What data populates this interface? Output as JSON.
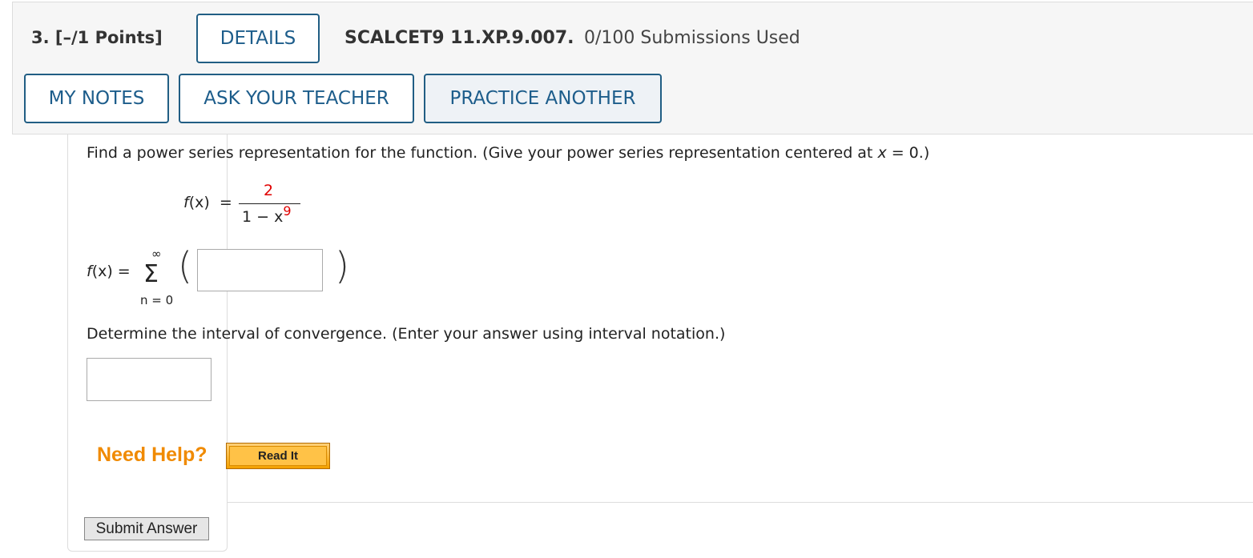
{
  "header": {
    "question_number": "3.",
    "points": "[–/1 Points]",
    "details_label": "DETAILS",
    "assignment_id": "SCALCET9 11.XP.9.007.",
    "submissions": "0/100 Submissions Used",
    "my_notes_label": "MY NOTES",
    "ask_teacher_label": "ASK YOUR TEACHER",
    "practice_another_label": "PRACTICE ANOTHER"
  },
  "question": {
    "prompt_part1": "Find a power series representation for the function. (Give your power series representation centered at ",
    "prompt_var": "x",
    "prompt_part2": " = 0.)",
    "function_lhs_name": "f",
    "function_lhs_arg": "(x)",
    "equals": "=",
    "numerator": "2",
    "denominator_base": "1 − x",
    "denominator_exp": "9",
    "series_lhs_name": "f",
    "series_lhs_arg": "(x) =",
    "sigma": "Σ",
    "sigma_upper": "∞",
    "sigma_lower": "n = 0",
    "paren_open": "(",
    "paren_close": ")",
    "series_answer_value": "",
    "interval_prompt": "Determine the interval of convergence. (Enter your answer using interval notation.)",
    "interval_answer_value": ""
  },
  "help": {
    "need_help": "Need Help?",
    "read_it_label": "Read It"
  },
  "submit_label": "Submit Answer",
  "colors": {
    "button_border": "#215e84",
    "button_text": "#1d5d8b",
    "accent_red": "#e00000",
    "help_orange": "#f08a00"
  }
}
